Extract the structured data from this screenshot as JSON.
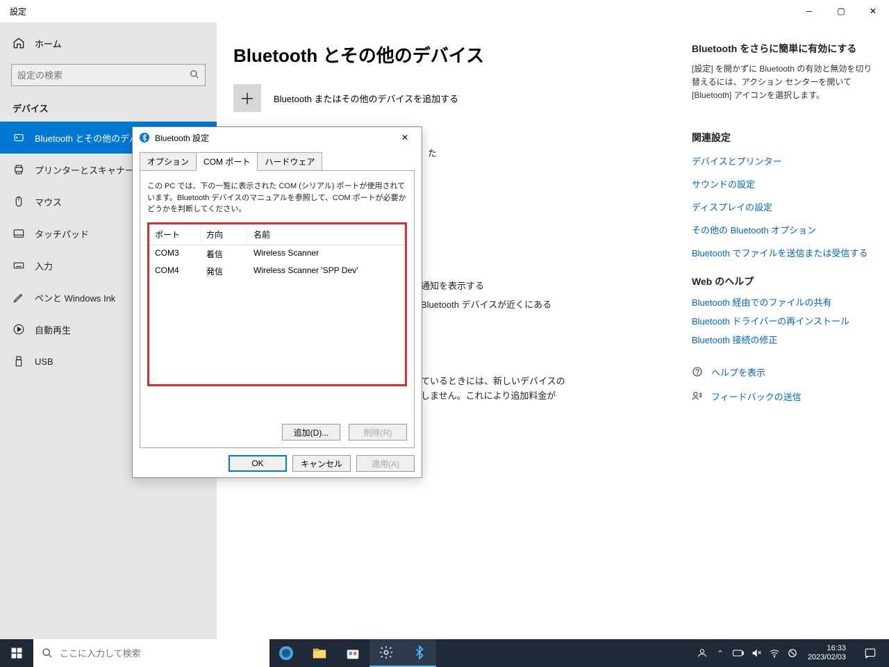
{
  "window": {
    "title": "設定"
  },
  "sidebar": {
    "home": "ホーム",
    "search_placeholder": "設定の検索",
    "category": "デバイス",
    "items": [
      {
        "label": "Bluetooth とその他のデバイス"
      },
      {
        "label": "プリンターとスキャナー"
      },
      {
        "label": "マウス"
      },
      {
        "label": "タッチパッド"
      },
      {
        "label": "入力"
      },
      {
        "label": "ペンと Windows Ink"
      },
      {
        "label": "自動再生"
      },
      {
        "label": "USB"
      }
    ]
  },
  "main": {
    "title": "Bluetooth とその他のデバイス",
    "add_device": "Bluetooth またはその他のデバイスを追加する",
    "partial1": "通知を表示する",
    "partial2": "Bluetooth デバイスが近くにある",
    "partial3": "ているときには、新しいデバイスの",
    "partial4": "しません。これにより追加料金が"
  },
  "right": {
    "h1": "Bluetooth をさらに簡単に有効にする",
    "p1": "[設定] を開かずに Bluetooth の有効と無効を切り替えるには、アクション センターを開いて [Bluetooth] アイコンを選択します。",
    "h2": "関連設定",
    "links2": [
      "デバイスとプリンター",
      "サウンドの設定",
      "ディスプレイの設定",
      "その他の Bluetooth オプション",
      "Bluetooth でファイルを送信または受信する"
    ],
    "h3": "Web のヘルプ",
    "links3": [
      "Bluetooth 経由でのファイルの共有",
      "Bluetooth ドライバーの再インストール",
      "Bluetooth 接続の修正"
    ],
    "help": "ヘルプを表示",
    "feedback": "フィードバックの送信"
  },
  "dialog": {
    "title": "Bluetooth 設定",
    "tabs": [
      "オプション",
      "COM ポート",
      "ハードウェア"
    ],
    "desc": "この PC では、下の一覧に表示された COM (シリアル) ポートが使用されています。Bluetooth デバイスのマニュアルを参照して、COM ポートが必要かどうかを判断してください。",
    "cols": {
      "port": "ポート",
      "dir": "方向",
      "name": "名前"
    },
    "rows": [
      {
        "port": "COM3",
        "dir": "着信",
        "name": "Wireless Scanner"
      },
      {
        "port": "COM4",
        "dir": "発信",
        "name": "Wireless Scanner 'SPP Dev'"
      }
    ],
    "add": "追加(D)...",
    "del": "削除(R)",
    "ok": "OK",
    "cancel": "キャンセル",
    "apply": "適用(A)"
  },
  "taskbar": {
    "search_placeholder": "ここに入力して検索",
    "time": "16:33",
    "date": "2023/02/03"
  }
}
